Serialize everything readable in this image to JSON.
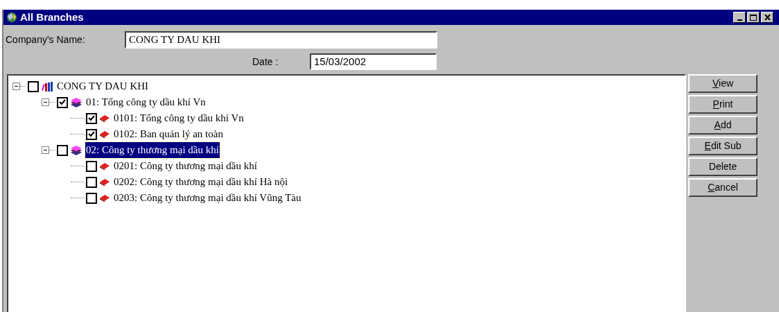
{
  "window": {
    "title": "All Branches"
  },
  "company_name": {
    "label": "Company's Name:",
    "value": "CONG TY DAU KHI"
  },
  "date": {
    "label": "Date :",
    "value": "15/03/2002"
  },
  "tree": [
    {
      "label": "CONG TY DAU KHI",
      "checked": false,
      "selected": false,
      "expanded": true,
      "children": [
        {
          "label": "01: Tổng công ty dầu khí Vn",
          "checked": true,
          "selected": false,
          "expanded": true,
          "children": [
            {
              "label": "0101: Tổng công ty dầu khí Vn",
              "checked": true,
              "selected": false
            },
            {
              "label": "0102: Ban quản lý an toàn",
              "checked": true,
              "selected": false
            }
          ]
        },
        {
          "label": "02: Công ty thương mại dầu khí",
          "checked": false,
          "selected": true,
          "expanded": true,
          "children": [
            {
              "label": "0201: Công ty thương mại dầu khí",
              "checked": false,
              "selected": false
            },
            {
              "label": "0202: Công ty thương mại dầu khí Hà nội",
              "checked": false,
              "selected": false
            },
            {
              "label": "0203: Công ty thương mại dầu khí Vũng Tàu",
              "checked": false,
              "selected": false
            }
          ]
        }
      ]
    }
  ],
  "buttons": [
    {
      "label": "View",
      "mnemonic": true
    },
    {
      "label": "Print",
      "mnemonic": true
    },
    {
      "label": "Add",
      "mnemonic": true
    },
    {
      "label": "Edit Sub",
      "mnemonic": true
    },
    {
      "label": "Delete",
      "mnemonic": false
    },
    {
      "label": "Cancel",
      "mnemonic": true
    }
  ]
}
